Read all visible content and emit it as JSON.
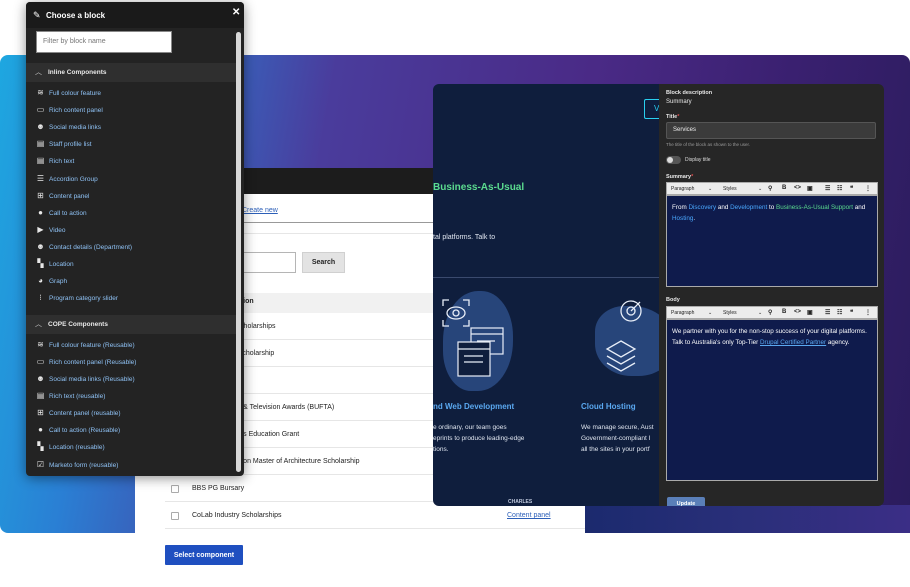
{
  "modal": {
    "title": "Choose a block",
    "filter_placeholder": "Filter by block name",
    "sections": [
      {
        "title": "Inline Components",
        "items": [
          {
            "label": "Full colour feature",
            "icon": "full-colour-feature-icon"
          },
          {
            "label": "Rich content panel",
            "icon": "rich-content-panel-icon"
          },
          {
            "label": "Social media links",
            "icon": "social-media-links-icon"
          },
          {
            "label": "Staff profile list",
            "icon": "staff-profile-list-icon"
          },
          {
            "label": "Rich text",
            "icon": "rich-text-icon"
          },
          {
            "label": "Accordion Group",
            "icon": "accordion-group-icon"
          },
          {
            "label": "Content panel",
            "icon": "content-panel-icon"
          },
          {
            "label": "Call to action",
            "icon": "call-to-action-icon"
          },
          {
            "label": "Video",
            "icon": "video-icon"
          },
          {
            "label": "Contact details (Department)",
            "icon": "contact-details-icon"
          },
          {
            "label": "Location",
            "icon": "location-icon"
          },
          {
            "label": "Graph",
            "icon": "graph-icon"
          },
          {
            "label": "Program category slider",
            "icon": "program-category-slider-icon"
          }
        ]
      },
      {
        "title": "COPE Components",
        "items": [
          {
            "label": "Full colour feature (Reusable)",
            "icon": "full-colour-feature-icon"
          },
          {
            "label": "Rich content panel (Reusable)",
            "icon": "rich-content-panel-icon"
          },
          {
            "label": "Social media links (Reusable)",
            "icon": "social-media-links-icon"
          },
          {
            "label": "Rich text (reusable)",
            "icon": "rich-text-icon"
          },
          {
            "label": "Content panel (reusable)",
            "icon": "content-panel-icon"
          },
          {
            "label": "Call to action (Reusable)",
            "icon": "call-to-action-icon"
          },
          {
            "label": "Location (reusable)",
            "icon": "location-icon"
          },
          {
            "label": "Marketo form (reusable)",
            "icon": "marketo-form-icon"
          }
        ]
      }
    ]
  },
  "listing": {
    "create_link": "Create new",
    "search_button": "Search",
    "column_header": "cription",
    "rows": [
      {
        "name": "al Scholarships",
        "type": ""
      },
      {
        "name": "en Scholarship",
        "type": ""
      },
      {
        "name": "am",
        "type": ""
      },
      {
        "name": "Film & Television Awards (BUFTA)",
        "type": ""
      },
      {
        "name": "ations Education Grant",
        "type": ""
      },
      {
        "name": "ndation Master of Architecture Scholarship",
        "type": ""
      },
      {
        "name": "BBS PG Bursary",
        "type": ""
      },
      {
        "name": "CoLab Industry Scholarships",
        "type": "Content panel"
      }
    ],
    "select_button": "Select component"
  },
  "preview": {
    "tab_letter": "V",
    "hero_title": "Business-As-Usual",
    "hero_text": "tal platforms. Talk to",
    "col1_heading": "nd Web Development",
    "col1_lines": [
      "e ordinary, our team goes",
      "eprints to produce leading-edge",
      "tions."
    ],
    "col2_heading": "Cloud Hosting",
    "col2_lines": [
      "We manage secure, Aust",
      "Government-compliant I",
      "all the sites in your portf"
    ],
    "logos_text": "CHARLES"
  },
  "editor": {
    "block_description_label": "Block description",
    "block_description_value": "Summary",
    "title_label": "Title",
    "title_required_mark": "*",
    "title_value": "Services",
    "title_hint": "The title of the block as shown to the user.",
    "display_title_label": "Display title",
    "summary_label": "Summary",
    "summary_required_mark": "*",
    "body_label": "Body",
    "toolbar_paragraph": "Paragraph",
    "toolbar_styles": "Styles",
    "summary_text": {
      "p1": "From ",
      "discovery": "Discovery",
      "p2": " and ",
      "development": "Development",
      "p3": " to ",
      "bau": "Business-As-Usual",
      "support": "Support",
      "p4": " and ",
      "hosting": "Hosting",
      "p5": "."
    },
    "body_text": {
      "p1": "We partner with you for the non-stop success of your digital platforms. Talk to Australia's only Top-Tier ",
      "link": "Drupal Certified Partner",
      "p2": " agency."
    },
    "update_button": "Update"
  },
  "colors": {
    "link_blue": "#8fc2f5",
    "accent_green": "#5bdc8f",
    "primary_button": "#1f4fc0",
    "preview_bg": "#0f1e3d"
  }
}
